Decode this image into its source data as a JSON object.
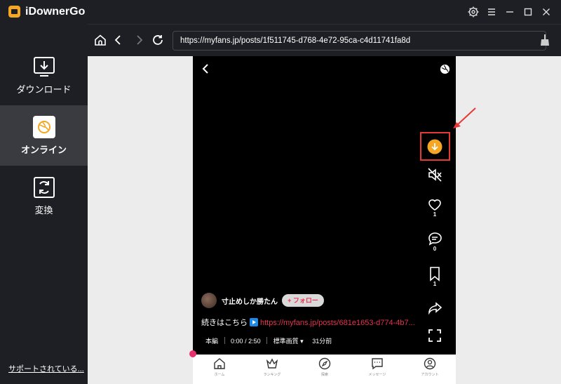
{
  "app": {
    "title": "iDownerGo"
  },
  "sidebar": {
    "items": [
      {
        "label": "ダウンロード",
        "icon": "download-icon",
        "active": false
      },
      {
        "label": "オンライン",
        "icon": "online-icon",
        "active": true
      },
      {
        "label": "変換",
        "icon": "convert-icon",
        "active": false
      }
    ],
    "support_link": "サポートされている..."
  },
  "toolbar": {
    "url": "https://myfans.jp/posts/1f511745-d768-4e72-95ca-c4d11741fa8d"
  },
  "video": {
    "author": "寸止めしか勝たん",
    "follow_label": "+ フォロー",
    "caption_text": "続きはこちら",
    "caption_link": "https://myfans.jp/posts/681e1653-d774-4b7...",
    "meta_tag": "本編",
    "time": "0:00 / 2:50",
    "quality": "標準画質",
    "posted": "31分前",
    "like_count": "1",
    "comment_count": "0",
    "bookmark_count": "1"
  },
  "phone_nav": {
    "items": [
      {
        "label": "ホーム",
        "icon": "home-icon"
      },
      {
        "label": "ランキング",
        "icon": "crown-icon"
      },
      {
        "label": "探索",
        "icon": "compass-icon"
      },
      {
        "label": "メッセージ",
        "icon": "message-icon"
      },
      {
        "label": "アカウント",
        "icon": "account-icon"
      }
    ]
  },
  "colors": {
    "accent": "#f5a623",
    "highlight": "#e53935",
    "link": "#e8304f"
  }
}
